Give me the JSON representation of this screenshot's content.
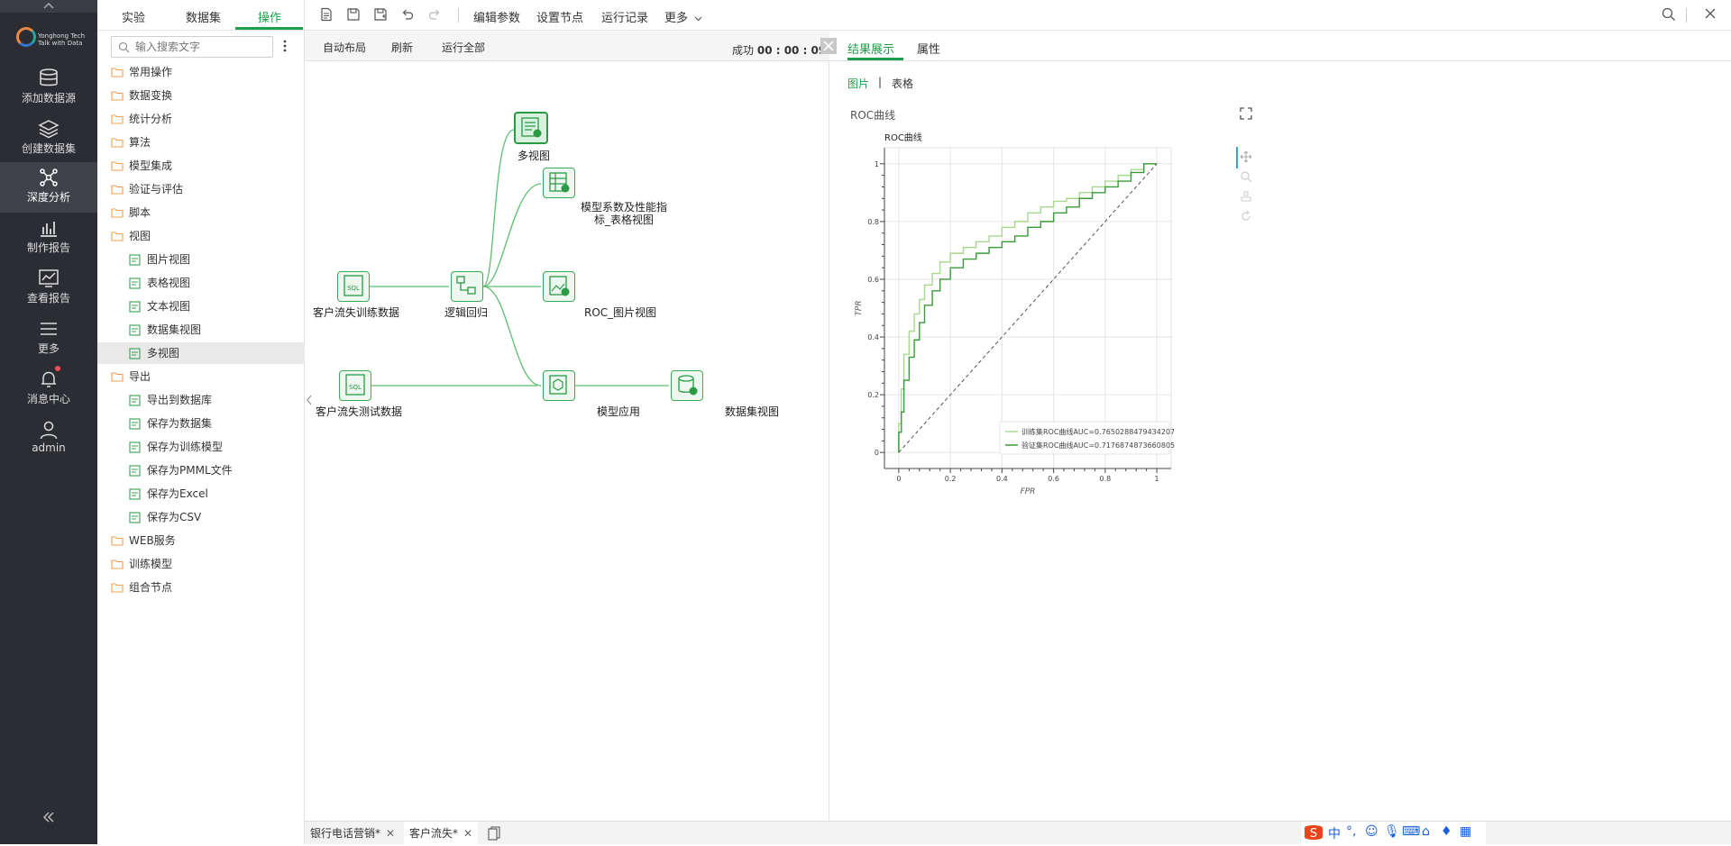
{
  "nav": {
    "logo_text": "Yonghong Tech",
    "logo_sub": "Talk with Data",
    "items": [
      {
        "label": "添加数据源",
        "icon": "database-icon"
      },
      {
        "label": "创建数据集",
        "icon": "layers-icon"
      },
      {
        "label": "深度分析",
        "icon": "network-icon"
      },
      {
        "label": "制作报告",
        "icon": "bar-chart-icon"
      },
      {
        "label": "查看报告",
        "icon": "line-chart-icon"
      },
      {
        "label": "更多",
        "icon": "menu-icon"
      },
      {
        "label": "消息中心",
        "icon": "bell-icon"
      },
      {
        "label": "admin",
        "icon": "user-icon"
      }
    ]
  },
  "side": {
    "tabs": [
      "实验",
      "数据集",
      "操作"
    ],
    "search_placeholder": "输入搜索文字",
    "tree": [
      {
        "label": "常用操作",
        "type": "folder"
      },
      {
        "label": "数据变换",
        "type": "folder"
      },
      {
        "label": "统计分析",
        "type": "folder"
      },
      {
        "label": "算法",
        "type": "folder"
      },
      {
        "label": "模型集成",
        "type": "folder"
      },
      {
        "label": "验证与评估",
        "type": "folder"
      },
      {
        "label": "脚本",
        "type": "folder"
      },
      {
        "label": "视图",
        "type": "folder"
      },
      {
        "label": "图片视图",
        "type": "item"
      },
      {
        "label": "表格视图",
        "type": "item"
      },
      {
        "label": "文本视图",
        "type": "item"
      },
      {
        "label": "数据集视图",
        "type": "item"
      },
      {
        "label": "多视图",
        "type": "item"
      },
      {
        "label": "导出",
        "type": "folder"
      },
      {
        "label": "导出到数据库",
        "type": "item"
      },
      {
        "label": "保存为数据集",
        "type": "item"
      },
      {
        "label": "保存为训练模型",
        "type": "item"
      },
      {
        "label": "保存为PMML文件",
        "type": "item"
      },
      {
        "label": "保存为Excel",
        "type": "item"
      },
      {
        "label": "保存为CSV",
        "type": "item"
      },
      {
        "label": "WEB服务",
        "type": "folder"
      },
      {
        "label": "训练模型",
        "type": "folder"
      },
      {
        "label": "组合节点",
        "type": "folder"
      }
    ]
  },
  "toolbar": {
    "edit_params": "编辑参数",
    "set_node": "设置节点",
    "run_log": "运行记录",
    "more": "更多"
  },
  "canvas": {
    "auto_layout": "自动布局",
    "refresh": "刷新",
    "run_all": "运行全部",
    "status_label": "成功",
    "status_time": "00 : 00 : 09",
    "nodes": {
      "train_data": "客户流失训练数据",
      "logistic": "逻辑回归",
      "multiview": "多视图",
      "coef_line1": "模型系数及性能指",
      "coef_line2": "标_表格视图",
      "roc_view": "ROC_图片视图",
      "test_data": "客户流失测试数据",
      "apply": "模型应用",
      "dataset_view": "数据集视图"
    }
  },
  "result": {
    "tabs": [
      "结果展示",
      "属性"
    ],
    "subtabs": [
      "图片",
      "表格"
    ],
    "subtab_sep": "|",
    "panel_title": "ROC曲线"
  },
  "chart_data": {
    "type": "line",
    "title": "ROC曲线",
    "xlabel": "FPR",
    "ylabel": "TPR",
    "xlim": [
      0,
      1
    ],
    "ylim": [
      0,
      1
    ],
    "xticks": [
      "0",
      "0.2",
      "0.4",
      "0.6",
      "0.8",
      "1"
    ],
    "yticks": [
      "0",
      "0.2",
      "0.4",
      "0.6",
      "0.8",
      "1"
    ],
    "grid": true,
    "legend_position": "bottom-right",
    "series": [
      {
        "name": "训练集ROC曲线AUC=0.7650288479434207",
        "color": "#a8d88c",
        "x": [
          0,
          0.01,
          0.02,
          0.04,
          0.06,
          0.08,
          0.1,
          0.13,
          0.16,
          0.2,
          0.25,
          0.3,
          0.35,
          0.4,
          0.45,
          0.5,
          0.55,
          0.6,
          0.65,
          0.7,
          0.75,
          0.8,
          0.85,
          0.9,
          0.95,
          1
        ],
        "y": [
          0,
          0.1,
          0.22,
          0.34,
          0.42,
          0.48,
          0.53,
          0.58,
          0.62,
          0.66,
          0.69,
          0.71,
          0.73,
          0.75,
          0.78,
          0.8,
          0.83,
          0.85,
          0.87,
          0.88,
          0.9,
          0.92,
          0.94,
          0.96,
          0.98,
          1
        ]
      },
      {
        "name": "验证集ROC曲线AUC=0.7176874873660805",
        "color": "#3a9a3a",
        "x": [
          0,
          0.01,
          0.02,
          0.04,
          0.06,
          0.08,
          0.1,
          0.13,
          0.16,
          0.2,
          0.25,
          0.3,
          0.35,
          0.4,
          0.45,
          0.5,
          0.55,
          0.6,
          0.65,
          0.7,
          0.75,
          0.8,
          0.85,
          0.9,
          0.95,
          1
        ],
        "y": [
          0,
          0.07,
          0.14,
          0.25,
          0.33,
          0.39,
          0.45,
          0.51,
          0.56,
          0.6,
          0.64,
          0.67,
          0.69,
          0.71,
          0.73,
          0.75,
          0.78,
          0.8,
          0.83,
          0.85,
          0.88,
          0.9,
          0.92,
          0.94,
          0.97,
          1
        ]
      },
      {
        "name": "",
        "color": "#555555",
        "dashed": true,
        "x": [
          0,
          1
        ],
        "y": [
          0,
          1
        ]
      }
    ]
  },
  "bottom": {
    "tabs": [
      "银行电话营销*",
      "客户流失*"
    ]
  },
  "ime": {
    "lang": "中"
  }
}
